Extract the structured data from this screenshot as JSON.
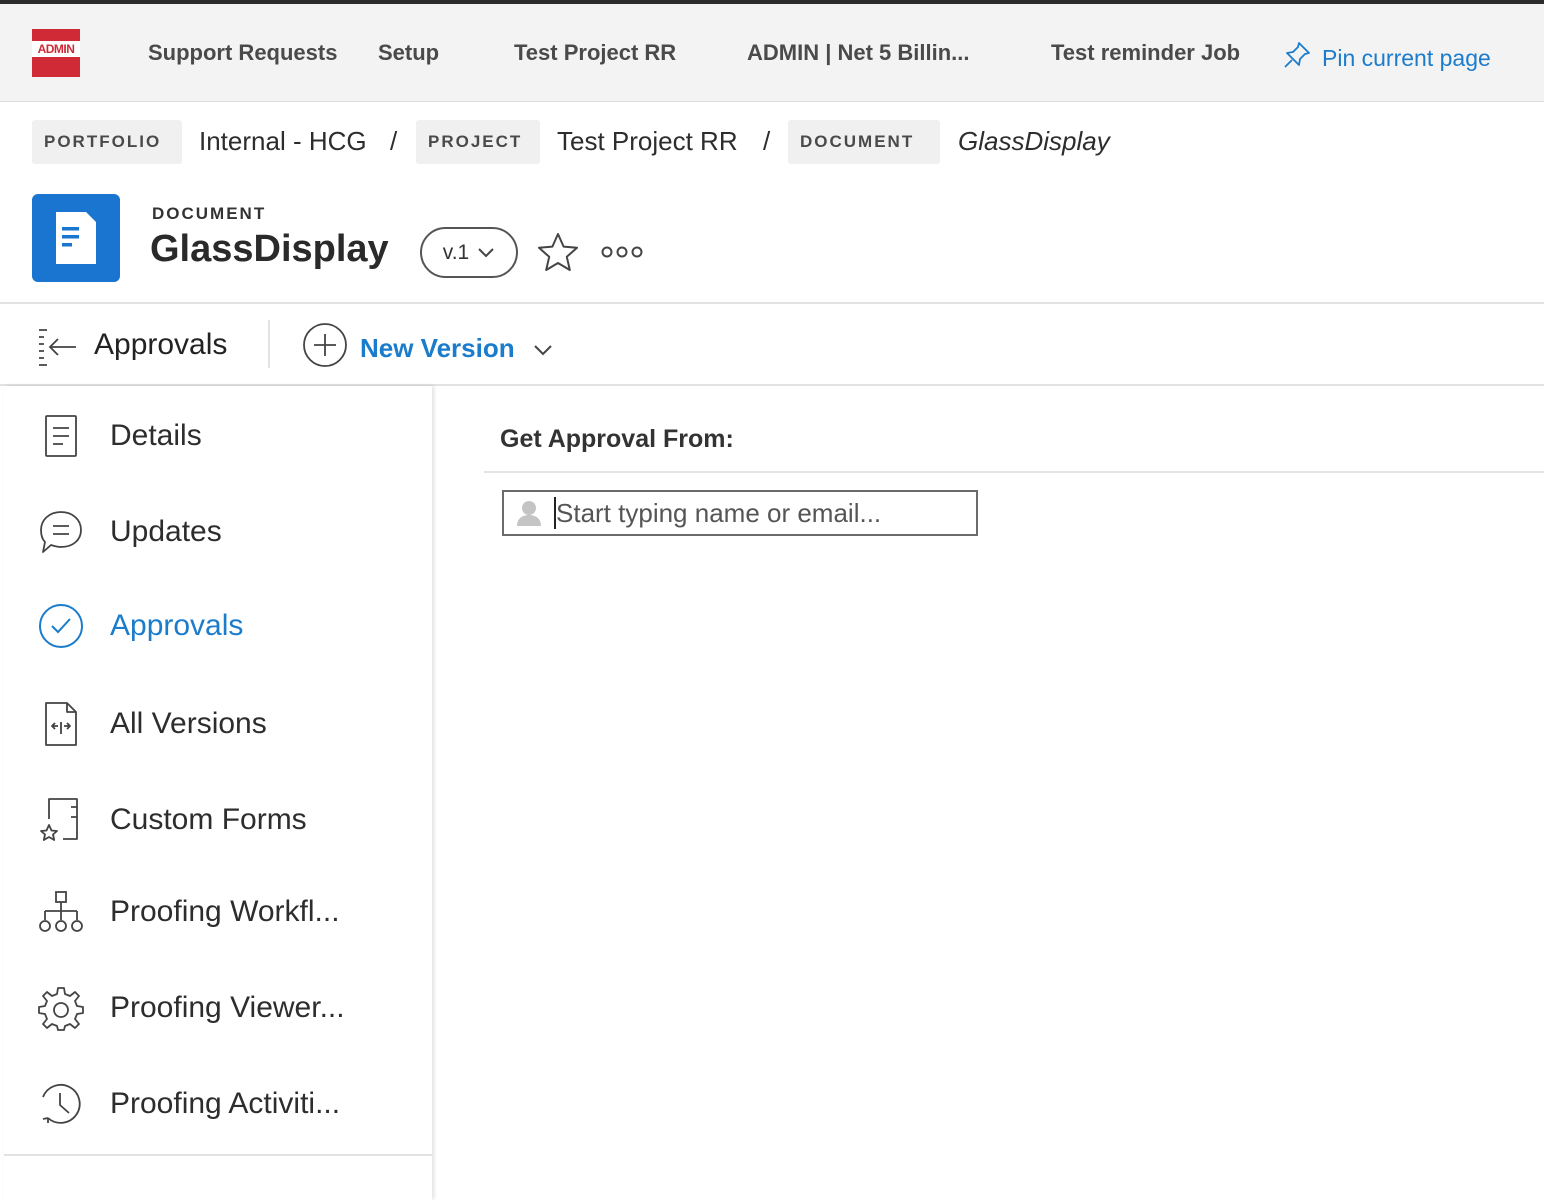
{
  "topbar": {
    "logo_text": "ADMIN",
    "nav": [
      "Support Requests",
      "Setup",
      "Test Project RR",
      "ADMIN | Net 5 Billin...",
      "Test reminder Job"
    ],
    "pin_label": "Pin current page",
    "pin_icon": "pin-icon"
  },
  "breadcrumb": {
    "portfolio_label": "PORTFOLIO",
    "portfolio_value": "Internal - HCG",
    "project_label": "PROJECT",
    "project_value": "Test Project RR",
    "document_label": "DOCUMENT",
    "document_value": "GlassDisplay",
    "separator": "/"
  },
  "header": {
    "kind": "DOCUMENT",
    "title": "GlassDisplay",
    "version": "v.1",
    "icons": [
      "document-icon",
      "star-icon",
      "more-icon"
    ]
  },
  "toolbar": {
    "title": "Approvals",
    "new_version_label": "New Version"
  },
  "sidebar": {
    "items": [
      {
        "label": "Details",
        "icon": "details-icon"
      },
      {
        "label": "Updates",
        "icon": "updates-icon"
      },
      {
        "label": "Approvals",
        "icon": "approvals-icon",
        "active": true
      },
      {
        "label": "All Versions",
        "icon": "versions-icon"
      },
      {
        "label": "Custom Forms",
        "icon": "custom-forms-icon"
      },
      {
        "label": "Proofing Workfl...",
        "icon": "workflow-icon"
      },
      {
        "label": "Proofing Viewer...",
        "icon": "gear-icon"
      },
      {
        "label": "Proofing Activiti...",
        "icon": "history-icon"
      }
    ]
  },
  "main": {
    "approval_heading": "Get Approval From:",
    "approver_input": {
      "value": "",
      "placeholder": "Start typing name or email..."
    }
  },
  "colors": {
    "accent": "#1b7ccc",
    "doc_tile": "#1975cf",
    "logo": "#cf2a35",
    "topbar_bg": "#f3f3f3"
  }
}
